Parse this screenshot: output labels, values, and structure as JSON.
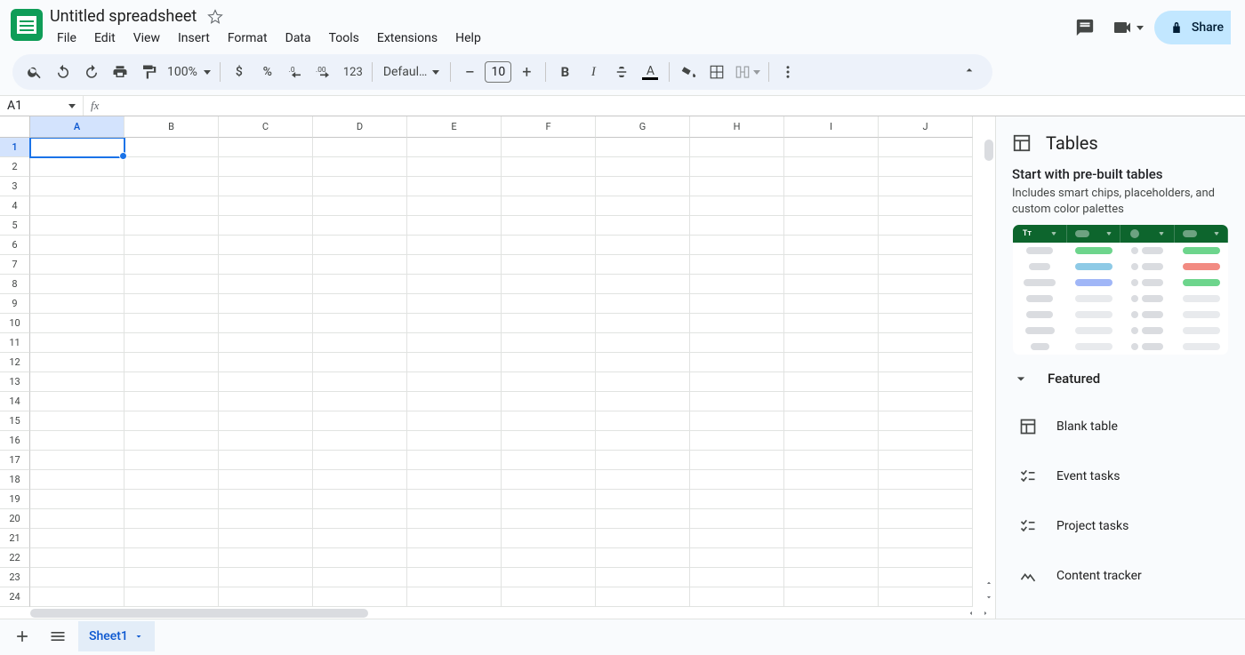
{
  "header": {
    "title": "Untitled spreadsheet",
    "menus": [
      "File",
      "Edit",
      "View",
      "Insert",
      "Format",
      "Data",
      "Tools",
      "Extensions",
      "Help"
    ],
    "share_label": "Share"
  },
  "toolbar": {
    "zoom": "100%",
    "font": "Defaul…",
    "font_size": "10",
    "numfmt_123": "123"
  },
  "formula": {
    "cell_ref": "A1",
    "fx_label": "fx",
    "value": ""
  },
  "grid": {
    "columns": [
      "A",
      "B",
      "C",
      "D",
      "E",
      "F",
      "G",
      "H",
      "I",
      "J"
    ],
    "rows": [
      1,
      2,
      3,
      4,
      5,
      6,
      7,
      8,
      9,
      10,
      11,
      12,
      13,
      14,
      15,
      16,
      17,
      18,
      19,
      20,
      21,
      22,
      23,
      24
    ],
    "selected_cell": "A1"
  },
  "sidepanel": {
    "title": "Tables",
    "subtitle": "Start with pre-built tables",
    "subdesc": "Includes smart chips, placeholders, and custom color palettes",
    "section": "Featured",
    "templates": [
      "Blank table",
      "Event tasks",
      "Project tasks",
      "Content tracker"
    ]
  },
  "sheetbar": {
    "sheet_name": "Sheet1"
  }
}
